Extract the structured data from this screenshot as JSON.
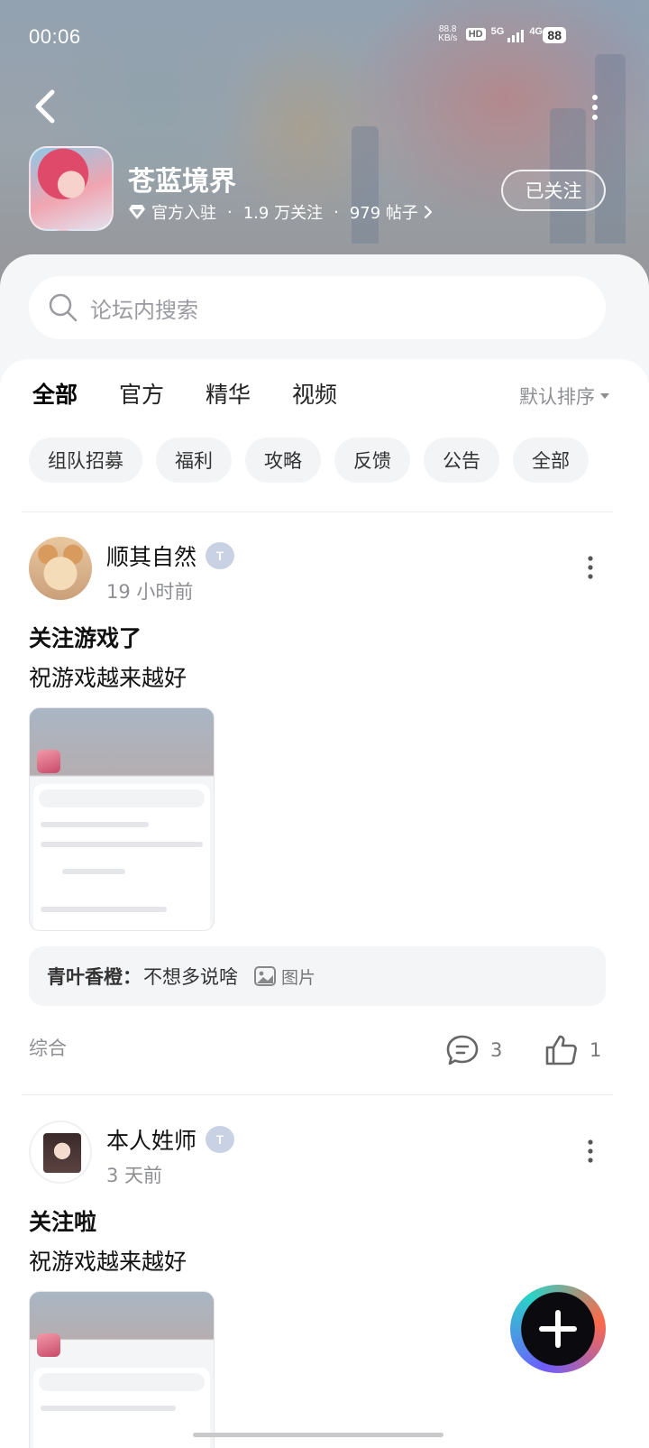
{
  "status": {
    "time": "00:06",
    "net_speed_top": "88.8",
    "net_speed_unit": "KB/s",
    "hd_label": "HD",
    "signal_1": "5G",
    "signal_2": "4G",
    "battery": "88"
  },
  "forum": {
    "name": "苍蓝境界",
    "official_label": "官方入驻",
    "followers": "1.9 万关注",
    "posts": "979 帖子",
    "follow_button": "已关注"
  },
  "search": {
    "placeholder": "论坛内搜索"
  },
  "tabs": [
    {
      "label": "全部",
      "active": true
    },
    {
      "label": "官方"
    },
    {
      "label": "精华"
    },
    {
      "label": "视频"
    }
  ],
  "sort_label": "默认排序",
  "chips": [
    "组队招募",
    "福利",
    "攻略",
    "反馈",
    "公告",
    "全部"
  ],
  "posts": [
    {
      "author": "顺其自然",
      "time": "19 小时前",
      "title": "关注游戏了",
      "body": "祝游戏越来越好",
      "reply": {
        "user": "青叶香橙：",
        "text": "不想多说啥",
        "image_label": "图片"
      },
      "category": "综合",
      "comments": "3",
      "likes": "1"
    },
    {
      "author": "本人姓师",
      "time": "3 天前",
      "title": "关注啦",
      "body": "祝游戏越来越好"
    }
  ],
  "colors": {
    "accent": "#36d6c6",
    "muted": "#8e8f93"
  }
}
